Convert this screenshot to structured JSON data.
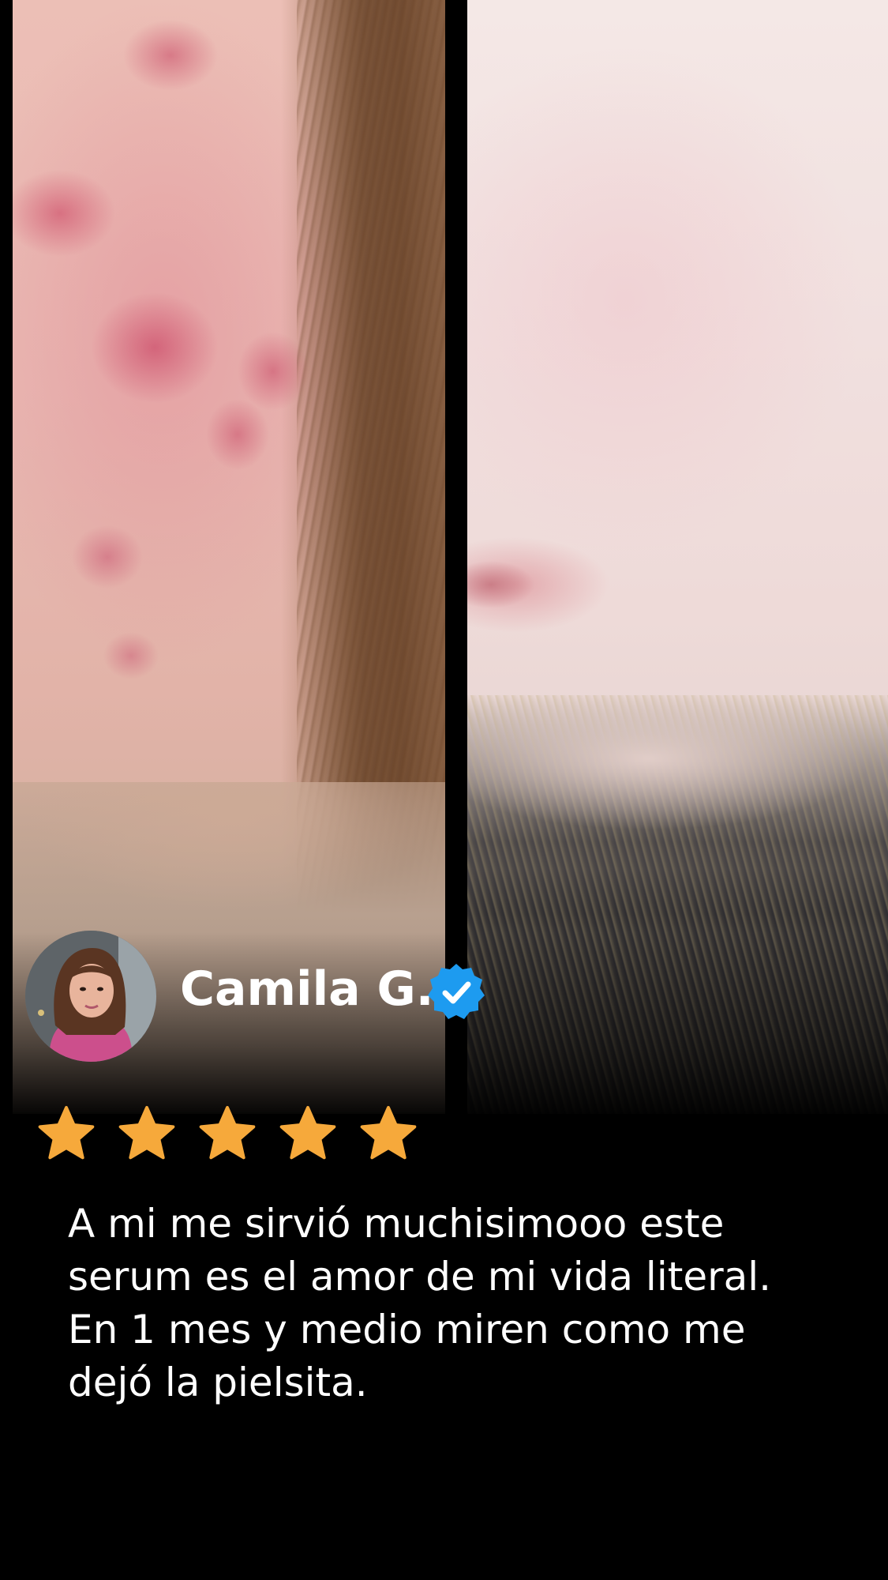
{
  "reviewer": {
    "name": "Camila G.",
    "avatar_icon": "profile-photo",
    "verified_icon": "verified-badge-icon",
    "verified_color": "#1d9bf0"
  },
  "rating": {
    "stars": 5,
    "max": 5,
    "star_color": "#f6a93b"
  },
  "review": {
    "lines": [
      "A mi me sirvió muchisimooo este",
      "serum es el amor de mi vida literal.",
      "En 1 mes y medio miren como me",
      "dejó la pielsita."
    ]
  },
  "photos": {
    "before_icon": "before-photo",
    "after_icon": "after-photo"
  }
}
